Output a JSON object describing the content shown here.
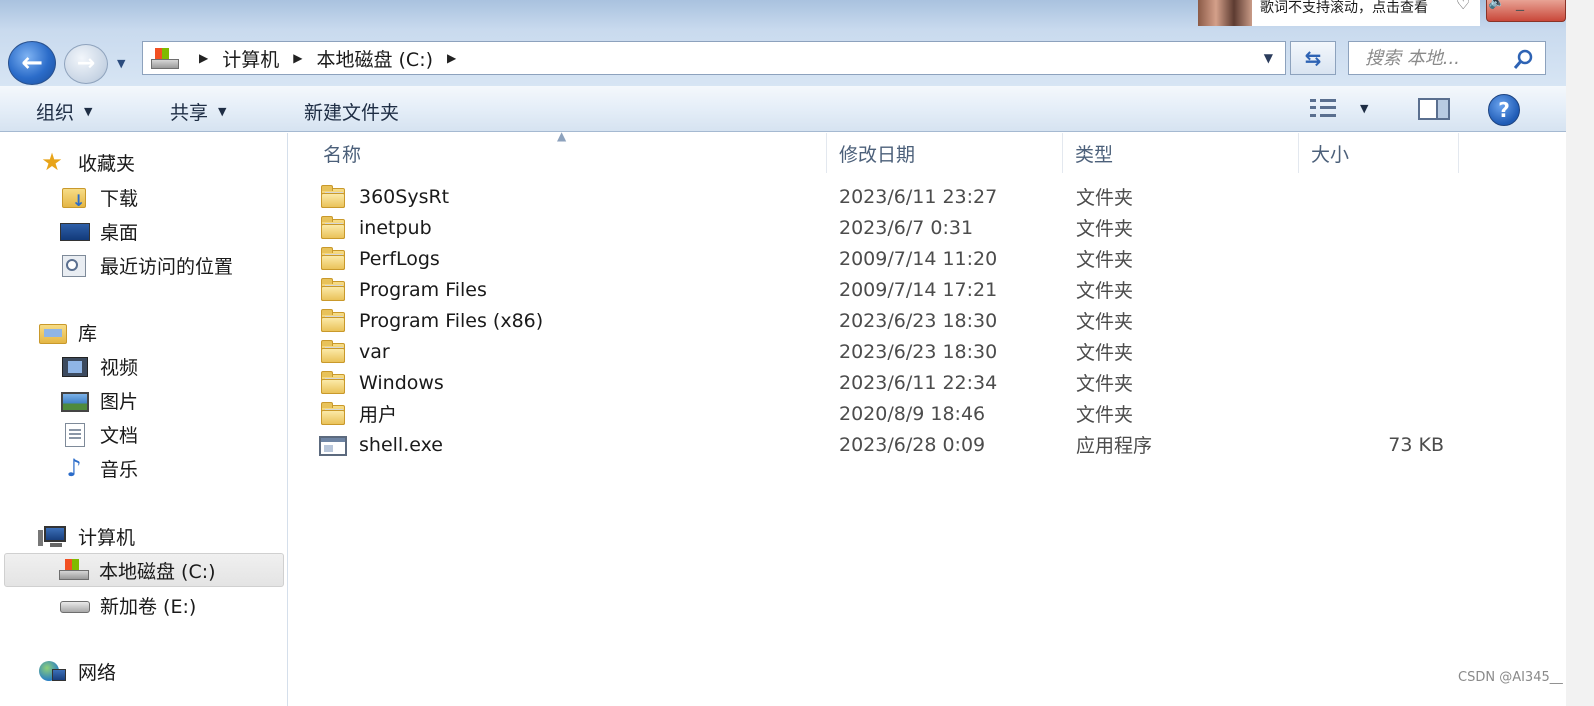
{
  "address_bar": {
    "segments": [
      "计算机",
      "本地磁盘 (C:)"
    ]
  },
  "search": {
    "placeholder": "搜索 本地..."
  },
  "notification": {
    "text": "歌词不支持滚动，点击查看"
  },
  "toolbar": {
    "organize": "组织",
    "share": "共享",
    "new_folder": "新建文件夹",
    "help_glyph": "?"
  },
  "sidebar": {
    "favorites": {
      "label": "收藏夹",
      "items": [
        "下载",
        "桌面",
        "最近访问的位置"
      ]
    },
    "libraries": {
      "label": "库",
      "items": [
        "视频",
        "图片",
        "文档",
        "音乐"
      ]
    },
    "computer": {
      "label": "计算机",
      "items": [
        "本地磁盘 (C:)",
        "新加卷 (E:)"
      ],
      "selected": "本地磁盘 (C:)"
    },
    "network": {
      "label": "网络"
    }
  },
  "columns": {
    "name": "名称",
    "date": "修改日期",
    "type": "类型",
    "size": "大小"
  },
  "files": [
    {
      "name": "360SysRt",
      "date": "2023/6/11 23:27",
      "type": "文件夹",
      "size": "",
      "icon": "folder-icon"
    },
    {
      "name": "inetpub",
      "date": "2023/6/7 0:31",
      "type": "文件夹",
      "size": "",
      "icon": "folder-icon"
    },
    {
      "name": "PerfLogs",
      "date": "2009/7/14 11:20",
      "type": "文件夹",
      "size": "",
      "icon": "folder-icon"
    },
    {
      "name": "Program Files",
      "date": "2009/7/14 17:21",
      "type": "文件夹",
      "size": "",
      "icon": "folder-icon"
    },
    {
      "name": "Program Files (x86)",
      "date": "2023/6/23 18:30",
      "type": "文件夹",
      "size": "",
      "icon": "folder-icon"
    },
    {
      "name": "var",
      "date": "2023/6/23 18:30",
      "type": "文件夹",
      "size": "",
      "icon": "folder-icon"
    },
    {
      "name": "Windows",
      "date": "2023/6/11 22:34",
      "type": "文件夹",
      "size": "",
      "icon": "folder-icon"
    },
    {
      "name": "用户",
      "date": "2020/8/9 18:46",
      "type": "文件夹",
      "size": "",
      "icon": "folder-icon"
    },
    {
      "name": "shell.exe",
      "date": "2023/6/28 0:09",
      "type": "应用程序",
      "size": "73 KB",
      "icon": "application-icon"
    }
  ],
  "watermark": "CSDN @AI345__"
}
